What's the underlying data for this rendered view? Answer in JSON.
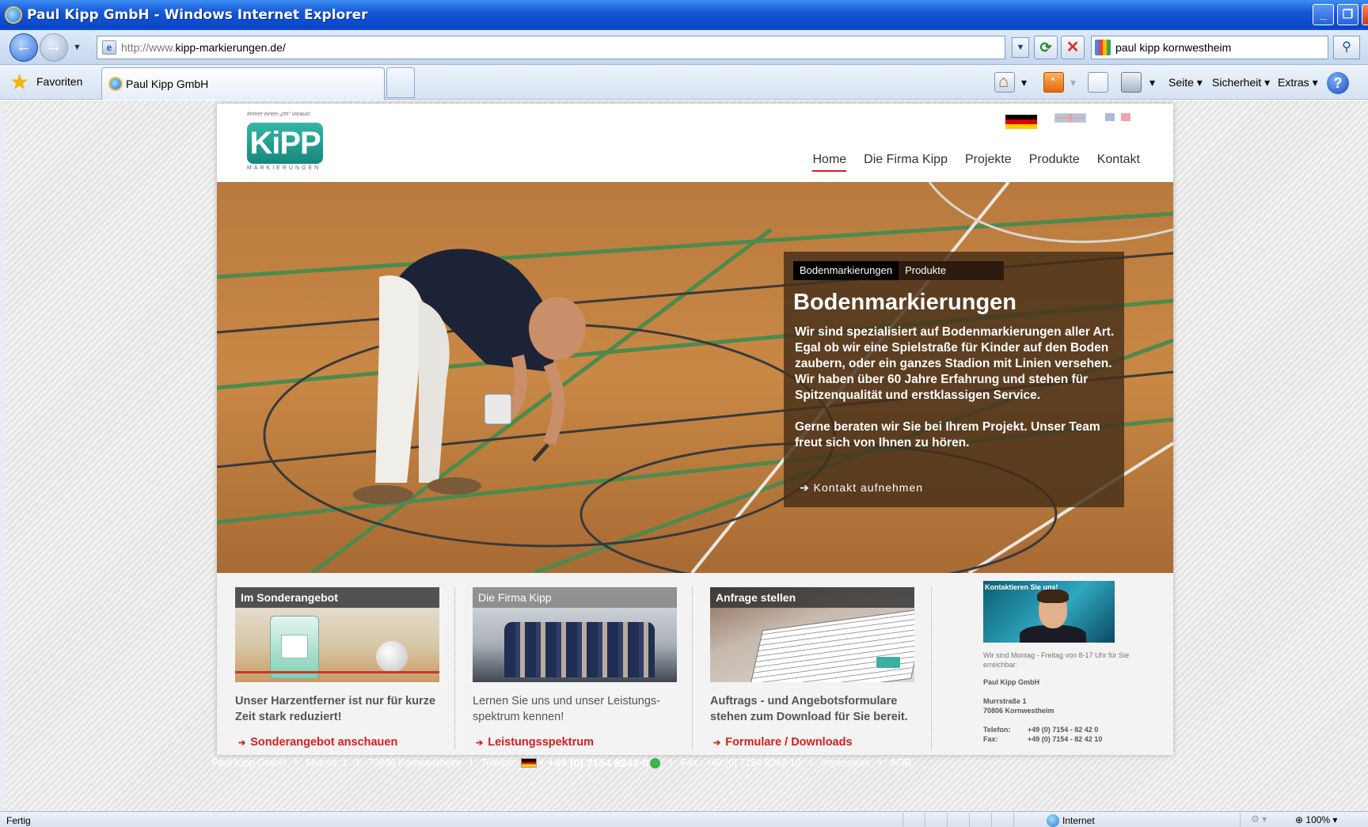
{
  "browser": {
    "window_title": "Paul Kipp GmbH - Windows Internet Explorer",
    "url_prefix": "http://www.",
    "url_host": "kipp-markierungen.de/",
    "search_query": "paul kipp kornwestheim",
    "favorites_label": "Favoriten",
    "tab_label": "Paul Kipp GmbH",
    "toolbar": {
      "seite": "Seite",
      "sicherheit": "Sicherheit",
      "extras": "Extras"
    },
    "status_left": "Fertig",
    "zone": "Internet",
    "zoom": "100%"
  },
  "site": {
    "logo_tagline": "Immer einen „cm“ voraus!",
    "logo_text": "KiPP",
    "logo_subtitle": "MARKIERUNGEN",
    "nav": [
      "Home",
      "Die Firma Kipp",
      "Projekte",
      "Produkte",
      "Kontakt"
    ],
    "nav_active": "Home",
    "hero": {
      "tabs": [
        "Bodenmarkierungen",
        "Produkte"
      ],
      "title": "Bodenmarkierungen",
      "paragraph1": "Wir sind spezialisiert auf Bodenmarkierungen aller Art. Egal ob wir eine Spielstraße für Kinder auf den Boden zaubern, oder ein ganzes Stadion mit Linien versehen.",
      "paragraph1b": "Wir haben über 60 Jahre Erfahrung und stehen für Spitzenqualität und erstklassigen Service.",
      "paragraph2": "Gerne beraten wir Sie bei Ihrem Projekt. Unser Team freut sich von Ihnen zu hören.",
      "link": "Kontakt aufnehmen"
    },
    "teasers": [
      {
        "caption": "Im Sonderangebot",
        "text": "Unser Harzentferner ist nur für kurze Zeit stark reduziert!",
        "link": "Sonderangebot anschauen"
      },
      {
        "caption": "Die Firma Kipp",
        "text": "Lernen Sie uns und unser Leistungs-spektrum kennen!",
        "link": "Leistungsspektrum"
      },
      {
        "caption": "Anfrage stellen",
        "text": "Auftrags - und Angebotsformulare stehen zum Download für Sie bereit.",
        "link": "Formulare / Downloads"
      }
    ],
    "contact": {
      "caption": "Kontaktieren Sie uns!",
      "hours": "Wir sind Montag - Freitag von 8-17 Uhr für Sie erreichbar:",
      "company": "Paul Kipp GmbH",
      "street": "Murrstraße 1",
      "city": "70806 Kornwestheim",
      "phone_label": "Telefon:",
      "phone": "+49 (0) 7154 - 82 42 0",
      "fax_label": "Fax:",
      "fax": "+49 (0) 7154 - 82 42 10"
    },
    "footer": {
      "company": "Paul Kipp GmbH",
      "street": "Murrstr. 1",
      "city": "70806 Kornwestheim",
      "phone_label": "Telefon :",
      "phone": "+49 (0) 7154 8242-0",
      "fax": "Fax : +49 (0) 7154 8242-10",
      "impressum": "Impressum",
      "agb": "AGB",
      "separator": "I"
    }
  }
}
